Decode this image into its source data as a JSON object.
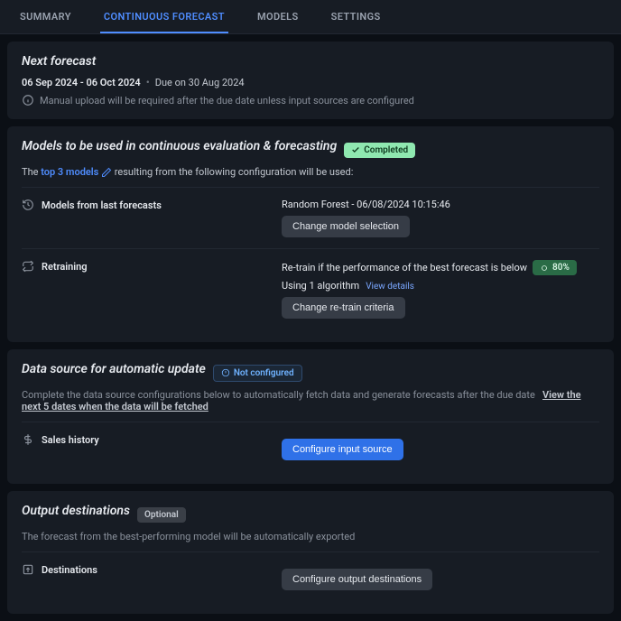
{
  "tabs": {
    "summary": "SUMMARY",
    "continuous": "CONTINUOUS FORECAST",
    "models": "MODELS",
    "settings": "SETTINGS",
    "active": "continuous"
  },
  "next_forecast": {
    "title": "Next forecast",
    "date_range": "06 Sep 2024 - 06 Oct 2024",
    "due": "Due on 30 Aug 2024",
    "info": "Manual upload will be required after the due date unless input sources are configured"
  },
  "models_section": {
    "title": "Models to be used in continuous evaluation & forecasting",
    "badge": "Completed",
    "config_line_pre": "The ",
    "config_line_link": "top 3 models",
    "config_line_post": " resulting from the following configuration will be used:",
    "last_forecasts": {
      "label": "Models from last forecasts",
      "value": "Random Forest - 06/08/2024 10:15:46",
      "button": "Change model selection"
    },
    "retraining": {
      "label": "Retraining",
      "line1_pre": "Re-train if the performance of the best forecast is below",
      "pct": "80%",
      "line2": "Using 1 algorithm",
      "view_details": "View details",
      "button": "Change re-train criteria"
    }
  },
  "data_source": {
    "title": "Data source for automatic update",
    "badge": "Not configured",
    "subtitle_pre": "Complete the data source configurations below to automatically fetch data and generate forecasts after the due date",
    "subtitle_link": "View the next 5 dates when the data will be fetched",
    "sales_history": {
      "label": "Sales history",
      "button": "Configure input source"
    }
  },
  "output": {
    "title": "Output destinations",
    "badge": "Optional",
    "subtitle": "The forecast from the best-performing model will be automatically exported",
    "destinations": {
      "label": "Destinations",
      "button": "Configure output destinations"
    }
  }
}
